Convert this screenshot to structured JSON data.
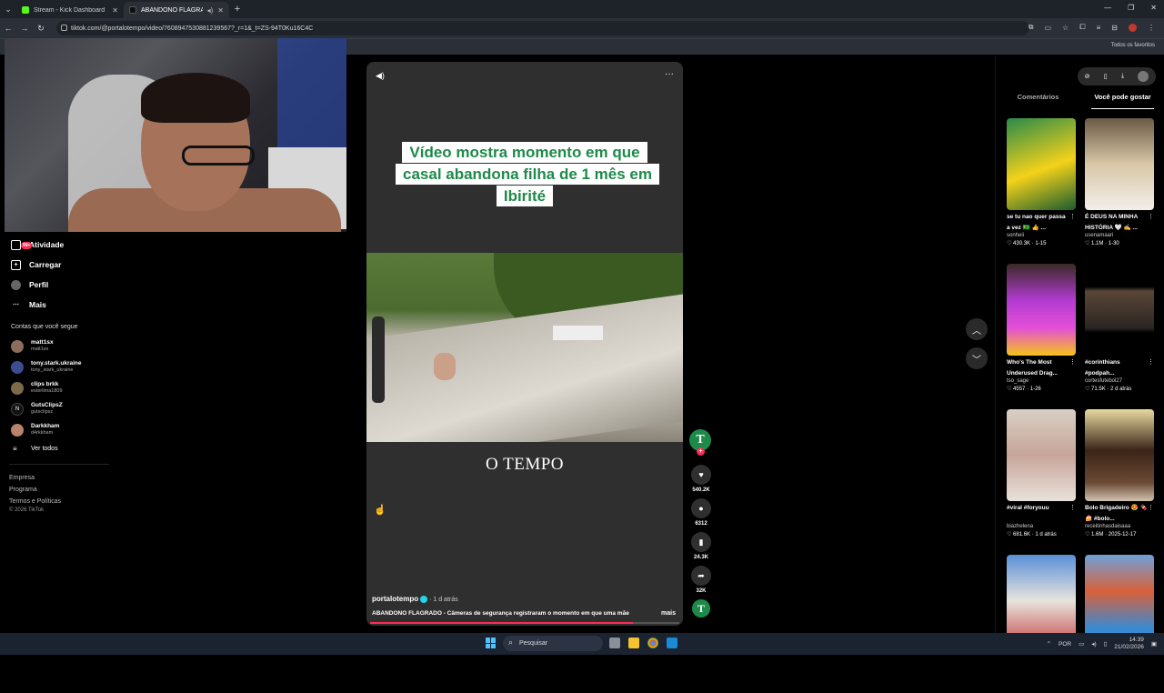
{
  "browser": {
    "tabs": [
      {
        "title": "Stream - Kick Dashboard",
        "favicon_color": "#53fc18",
        "active": false
      },
      {
        "title": "ABANDONO FLAGRADO -",
        "favicon_color": "#111111",
        "active": true
      }
    ],
    "url": "tiktok.com/@portalotempo/video/7608947530881239567?_r=1&_t=ZS-94T0Ku16C4C",
    "bookmarks_label": "Todos os favoritos"
  },
  "sidebar": {
    "items": [
      {
        "label": "Atividade",
        "badge": "99+",
        "icon": "inbox-icon"
      },
      {
        "label": "Carregar",
        "icon": "upload-icon"
      },
      {
        "label": "Perfil",
        "icon": "profile-icon"
      },
      {
        "label": "Mais",
        "icon": "more-icon"
      }
    ],
    "following_title": "Contas que você segue",
    "accounts": [
      {
        "name": "matt1sx",
        "handle": "matt1sx",
        "color": "#8a6d5c"
      },
      {
        "name": "tony.stark.ukraine",
        "handle": "tony_stark_ukraine",
        "color": "#3b4c8f"
      },
      {
        "name": "clips brkk",
        "handle": "esterlima1809",
        "color": "#7d6a4a"
      },
      {
        "name": "GutsClipsZ",
        "handle": "gutsclipsz",
        "color": "#111111"
      },
      {
        "name": "Darkkham",
        "handle": "d4rkkham",
        "color": "#b9826a"
      }
    ],
    "see_all": "Ver todos",
    "footer_links": [
      "Empresa",
      "Programa",
      "Termos e Políticas"
    ],
    "copyright": "© 2026 TikTok"
  },
  "video": {
    "headline": "Vídeo mostra momento em que casal abandona filha de 1 mês em Ibirité",
    "brand_text": "O TEMPO",
    "username": "portalotempo",
    "time_ago": "· 1 d atrás",
    "caption": "ABANDONO FLAGRADO - Câmeras de segurança registraram o momento em que uma mãe",
    "more_label": "mais",
    "progress": 0.85
  },
  "actions": {
    "likes": "540.2K",
    "comments": "6312",
    "saves": "24.3K",
    "shares": "32K",
    "avatar_letter": "T"
  },
  "right_panel": {
    "tabs": [
      "Comentários",
      "Você pode gostar"
    ],
    "active_tab": 1,
    "cards": [
      {
        "title": "se tu nao quer passa a vez 🇧🇷 👍 ...",
        "user": "sonheii",
        "likes": "♡ 430.3K",
        "date": "· 1-15",
        "bg": "linear-gradient(160deg,#2a8a4a,#f4d21a 55%,#1a5c2e)"
      },
      {
        "title": "É DEUS NA MINHA HISTÓRIA 🤍 ✍️ ...",
        "user": "usenamaari",
        "likes": "♡ 1.1M",
        "date": "· 1-30",
        "bg": "linear-gradient(180deg,#6b5a44,#d9c7a8 50%,#f2efe9)"
      },
      {
        "title": "Who's The Most Underused Drag...",
        "user": "tso_sage",
        "likes": "♡ 4557",
        "date": "· 1-26",
        "bg": "linear-gradient(180deg,#3a2a24 0%,#b23bd1 40%,#e34fd7 70%,#f6c41a 100%)"
      },
      {
        "title": "#corinthians #podpah...",
        "user": "cortesfutebol27",
        "likes": "♡ 71.5K",
        "date": "· 2 d atrás",
        "bg": "linear-gradient(180deg,#000 0%,#000 25%,#5a4638 30%,#2a2522 70%,#000 75%)"
      },
      {
        "title": "#viral #foryouu",
        "user": "biazhelena",
        "likes": "♡ 681.6K",
        "date": "· 1 d atrás",
        "bg": "linear-gradient(180deg,#d9cfc4,#c7a59a 50%,#e8e2da)"
      },
      {
        "title": "Bolo Brigadeiro 😍 🍫 🍰 #bolo...",
        "user": "receitinhasdaisaaa",
        "likes": "♡ 1.6M",
        "date": "· 2025-12-17",
        "bg": "linear-gradient(180deg,#e8d9a0 0%,#3a2418 45%,#6b4a34 80%,#cfc2b0 100%)"
      },
      {
        "title": "",
        "user": "",
        "likes": "",
        "date": "",
        "bg": "linear-gradient(180deg,#5a8fd6,#e8e4de 50%,#c54a4a)"
      },
      {
        "title": "",
        "user": "",
        "likes": "",
        "date": "",
        "bg": "linear-gradient(180deg,#6fa0d8,#d9603a 40%,#3a8ad1 80%)"
      }
    ]
  },
  "taskbar": {
    "search_placeholder": "Pesquisar",
    "lang": "POR",
    "time": "14:39",
    "date": "21/02/2026"
  }
}
